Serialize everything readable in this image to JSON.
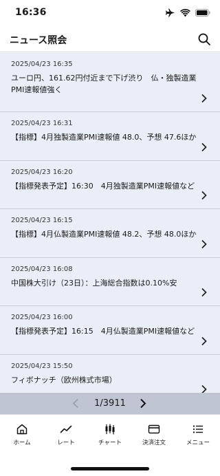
{
  "status_bar": {
    "time": "16:36",
    "icons": [
      "airplane-icon",
      "wifi-icon",
      "battery-icon"
    ]
  },
  "header": {
    "title": "ニュース照会",
    "search_icon": "search-icon"
  },
  "news": [
    {
      "date": "2025/04/23 16:35",
      "title": "ユーロ円、161.62円付近まで下げ渋り　仏・独製造業PMI速報値強く"
    },
    {
      "date": "2025/04/23 16:31",
      "title": "【指標】4月独製造業PMI速報値 48.0、予想 47.6ほか"
    },
    {
      "date": "2025/04/23 16:20",
      "title": "【指標発表予定】16:30　4月独製造業PMI速報値など"
    },
    {
      "date": "2025/04/23 16:15",
      "title": "【指標】4月仏製造業PMI速報値 48.2、予想 48.0ほか"
    },
    {
      "date": "2025/04/23 16:08",
      "title": "中国株大引け（23日）：上海総合指数は0.10%安"
    },
    {
      "date": "2025/04/23 16:00",
      "title": "【指標発表予定】16:15　4月仏製造業PMI速報値など"
    },
    {
      "date": "2025/04/23 15:50",
      "title": "フィボナッチ（欧州株式市場）"
    }
  ],
  "pager": {
    "text": "1/3911"
  },
  "tabs": [
    {
      "label": "ホーム",
      "icon": "home-icon"
    },
    {
      "label": "レート",
      "icon": "trend-line-icon"
    },
    {
      "label": "チャート",
      "icon": "candlestick-icon"
    },
    {
      "label": "決済注文",
      "icon": "card-icon"
    },
    {
      "label": "メニュー",
      "icon": "menu-list-icon"
    }
  ],
  "colors": {
    "list_background": "#eaeef8",
    "pager_background": "#bfc5d3",
    "divider": "#c9cdd8"
  }
}
